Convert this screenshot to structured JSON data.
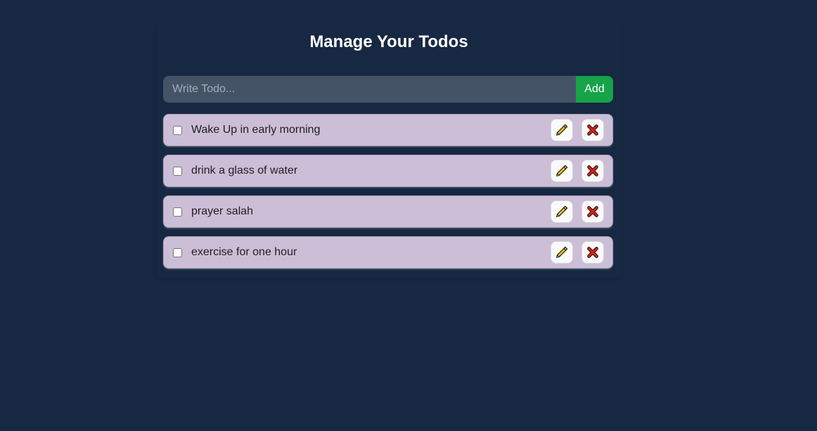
{
  "header": {
    "title": "Manage Your Todos"
  },
  "form": {
    "input_placeholder": "Write Todo...",
    "input_value": "",
    "add_label": "Add"
  },
  "todos": [
    {
      "text": "Wake Up in early morning",
      "completed": false,
      "edit_icon": "pencil-icon",
      "delete_icon": "x-icon"
    },
    {
      "text": "drink a glass of water",
      "completed": false,
      "edit_icon": "pencil-icon",
      "delete_icon": "x-icon"
    },
    {
      "text": "prayer salah",
      "completed": false,
      "edit_icon": "pencil-icon",
      "delete_icon": "x-icon"
    },
    {
      "text": "exercise for one hour",
      "completed": false,
      "edit_icon": "pencil-icon",
      "delete_icon": "x-icon"
    }
  ],
  "colors": {
    "background": "#172842",
    "item_background": "#ccbed7",
    "add_button": "#16a34a",
    "pencil": "#f5c518",
    "delete_x": "#d0251b"
  }
}
